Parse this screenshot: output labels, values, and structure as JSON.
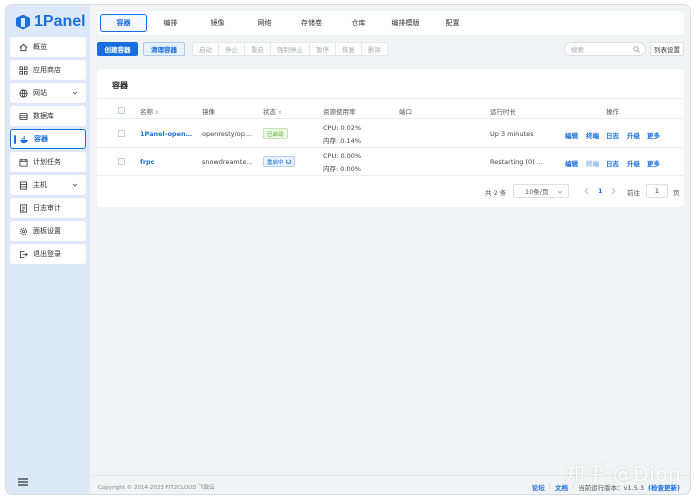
{
  "app": {
    "logo_text": "1Panel"
  },
  "sidebar": {
    "items": [
      {
        "label": "概览",
        "icon": "home-icon"
      },
      {
        "label": "应用商店",
        "icon": "grid-icon"
      },
      {
        "label": "网站",
        "icon": "globe-icon",
        "expandable": true
      },
      {
        "label": "数据库",
        "icon": "database-icon"
      },
      {
        "label": "容器",
        "icon": "docker-icon",
        "active": true
      },
      {
        "label": "计划任务",
        "icon": "calendar-icon"
      },
      {
        "label": "主机",
        "icon": "server-icon",
        "expandable": true
      },
      {
        "label": "日志审计",
        "icon": "log-icon"
      },
      {
        "label": "面板设置",
        "icon": "gear-icon"
      },
      {
        "label": "退出登录",
        "icon": "logout-icon"
      }
    ]
  },
  "tabs": [
    "容器",
    "编排",
    "镜像",
    "网络",
    "存储卷",
    "仓库",
    "编排模版",
    "配置"
  ],
  "toolbar": {
    "create": "创建容器",
    "clean": "清理容器",
    "actions": [
      "启动",
      "停止",
      "重启",
      "强制停止",
      "暂停",
      "恢复",
      "删除"
    ],
    "search_placeholder": "搜索",
    "columns": "列表设置"
  },
  "card": {
    "title": "容器"
  },
  "table": {
    "headers": {
      "name": "名称",
      "image": "镜像",
      "status": "状态",
      "resource": "资源使用率",
      "port": "端口",
      "uptime": "运行时长",
      "ops": "操作"
    },
    "rows": [
      {
        "name": "1Panel-openre...",
        "image": "openresty/ope...",
        "status": "已启动",
        "status_type": "running",
        "cpu": "CPU: 0.02%",
        "mem": "内存: 0.14%",
        "port": "",
        "uptime": "Up 3 minutes",
        "terminal_enabled": true
      },
      {
        "name": "frpc",
        "image": "snowdreamtec...",
        "status": "重启中",
        "status_type": "restarting",
        "cpu": "CPU: 0.00%",
        "mem": "内存: 0.00%",
        "port": "",
        "uptime": "Restarting (0) ...",
        "terminal_enabled": false
      }
    ],
    "ops": [
      "编辑",
      "终端",
      "日志",
      "升级",
      "更多"
    ]
  },
  "pagination": {
    "total": "共 2 条",
    "page_size": "10条/页",
    "current": "1",
    "goto_label": "前往",
    "goto_value": "1",
    "page_suffix": "页"
  },
  "footer": {
    "copyright": "Copyright © 2014-2023 FIT2CLOUD 飞致云",
    "forum": "论坛",
    "docs": "文档",
    "version_label": "当前运行版本：v1.5.3",
    "check_update": "(检查更新)"
  },
  "watermark": "知乎 @Dion",
  "colors": {
    "accent": "#1a6fe0",
    "sidebar_bg": "#dde9f8",
    "running": "#54a522"
  }
}
